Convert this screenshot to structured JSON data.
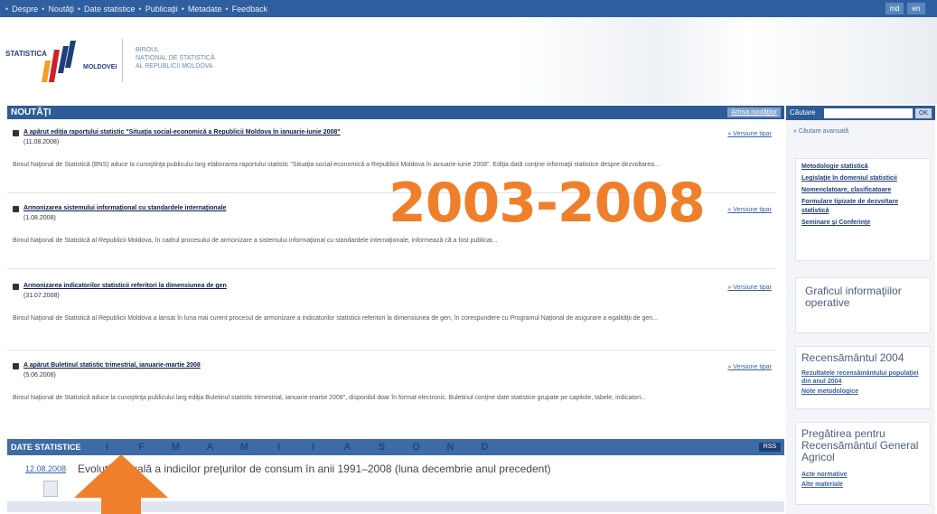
{
  "topbar": {
    "items": [
      "Despre",
      "Noutăţi",
      "Date statistice",
      "Publicaţii",
      "Metadate",
      "Feedback"
    ],
    "separator": "•",
    "languages": [
      "md",
      "en"
    ]
  },
  "header": {
    "logo_top": "STATISTICA",
    "logo_bottom": "MOLDOVEI",
    "bureau_lines": [
      "BIROUL",
      "NAŢIONAL DE STATISTICĂ",
      "AL REPUBLICII MOLDOVA"
    ]
  },
  "news": {
    "panel_title": "NOUTĂŢI",
    "archive_link": "Arhiva noutăţilor",
    "items": [
      {
        "title": "A apărut ediţia raportului statistic \"Situaţia social-economică a Republicii Moldova în ianuarie-iunie 2008\"",
        "date": "(11.08.2008)",
        "more": "» Versiune tipar",
        "body": "Biroul Naţional de Statistică (BNS) aduce la cunoştinţa publicului larg elaborarea raportului statistic \"Situaţia social-economică a Republicii Moldova în ianuarie-iunie 2008\". Ediţia dată conţine informaţii statistice despre dezvoltarea..."
      },
      {
        "title": "Armonizarea sistemului informaţional cu standardele internaţionale",
        "date": "(1.08.2008)",
        "more": "» Versiune tipar",
        "body": "Biroul Naţional de Statistică al Republicii Moldova, în cadrul procesului de armonizare a sistemului informaţional cu standardele internaţionale, informează că a fost publicat..."
      },
      {
        "title": "Armonizarea indicatorilor statisticii referitori la dimensiunea de gen",
        "date": "(31.07.2008)",
        "more": "» Versiune tipar",
        "body": "Biroul Naţional de Statistică al Republicii Moldova a lansat în luna mai curent procesul de armonizare a indicatorilor statisticii referitori la dimensiunea de gen, în corespundere cu Programul Naţional de asigurare a egalităţii de gen..."
      },
      {
        "title": "A apărut Buletinul statistic trimestrial, ianuarie-martie 2008",
        "date": "(5.06.2008)",
        "more": "» Versiune tipar",
        "body": "Biroul Naţional de Statistică aduce la cunoştinţa publicului larg ediţia Buletinul statistic trimestrial, ianuarie-martie 2008\", disponibil doar în format electronic. Buletinul conţine date statistice grupate pe capitole, tabele, indicatori..."
      }
    ]
  },
  "caption": "2003-2008",
  "date_statistice": {
    "title": "DATE STATISTICE",
    "months": [
      "I",
      "F",
      "M",
      "A",
      "M",
      "I",
      "I",
      "A",
      "S",
      "O",
      "N",
      "D"
    ],
    "rss": "RSS",
    "latest_date": "12.08.2008",
    "latest_text": "Evoluţia anuală a indicilor preţurilor de consum în anii 1991–2008 (luna decembrie anul precedent)"
  },
  "sidebar": {
    "search_label": "Căutare",
    "search_placeholder": "",
    "search_button": "OK",
    "advanced_search": "» Căutare avansată",
    "box1_links": [
      "Metodologie statistică",
      "Legislaţie în domeniul statisticii",
      "Nomenclatoare, clasificatoare",
      "Formulare tipizate de dezvoltare statistică",
      "Seminare şi Conferinţe"
    ],
    "box2_head": "Graficul informaţiilor operative",
    "box3_head": "Recensământul 2004",
    "box3_links": [
      "Rezultatele recensământului populaţiei din anul 2004",
      "Note metodologice"
    ],
    "box4_head": "Pregătirea pentru Recensământul General Agricol",
    "box4_links": [
      "Acte normative",
      "Alte materiale"
    ]
  },
  "colors": {
    "nav_blue": "#2f5f9e",
    "accent_orange": "#f07f2b"
  }
}
